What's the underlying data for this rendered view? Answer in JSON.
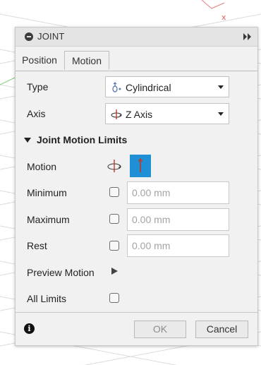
{
  "dialog": {
    "title": "JOINT"
  },
  "tabs": [
    {
      "label": "Position",
      "active": false
    },
    {
      "label": "Motion",
      "active": true
    }
  ],
  "fields": {
    "type": {
      "label": "Type",
      "value": "Cylindrical",
      "icon": "cylindrical-joint-icon"
    },
    "axis": {
      "label": "Axis",
      "value": "Z Axis",
      "icon": "rotate-axis-icon"
    }
  },
  "limits": {
    "section_label": "Joint Motion Limits",
    "motion_label": "Motion",
    "minimum": {
      "label": "Minimum",
      "placeholder": "0.00 mm",
      "checked": false
    },
    "maximum": {
      "label": "Maximum",
      "placeholder": "0.00 mm",
      "checked": false
    },
    "rest": {
      "label": "Rest",
      "placeholder": "0.00 mm",
      "checked": false
    },
    "preview_label": "Preview Motion",
    "all_limits_label": "All Limits"
  },
  "footer": {
    "info": "i",
    "ok_label": "OK",
    "cancel_label": "Cancel"
  },
  "colors": {
    "accent": "#1f8fd6",
    "axis_red": "#c0392b",
    "canvas_grid": "#d9d9d9"
  }
}
